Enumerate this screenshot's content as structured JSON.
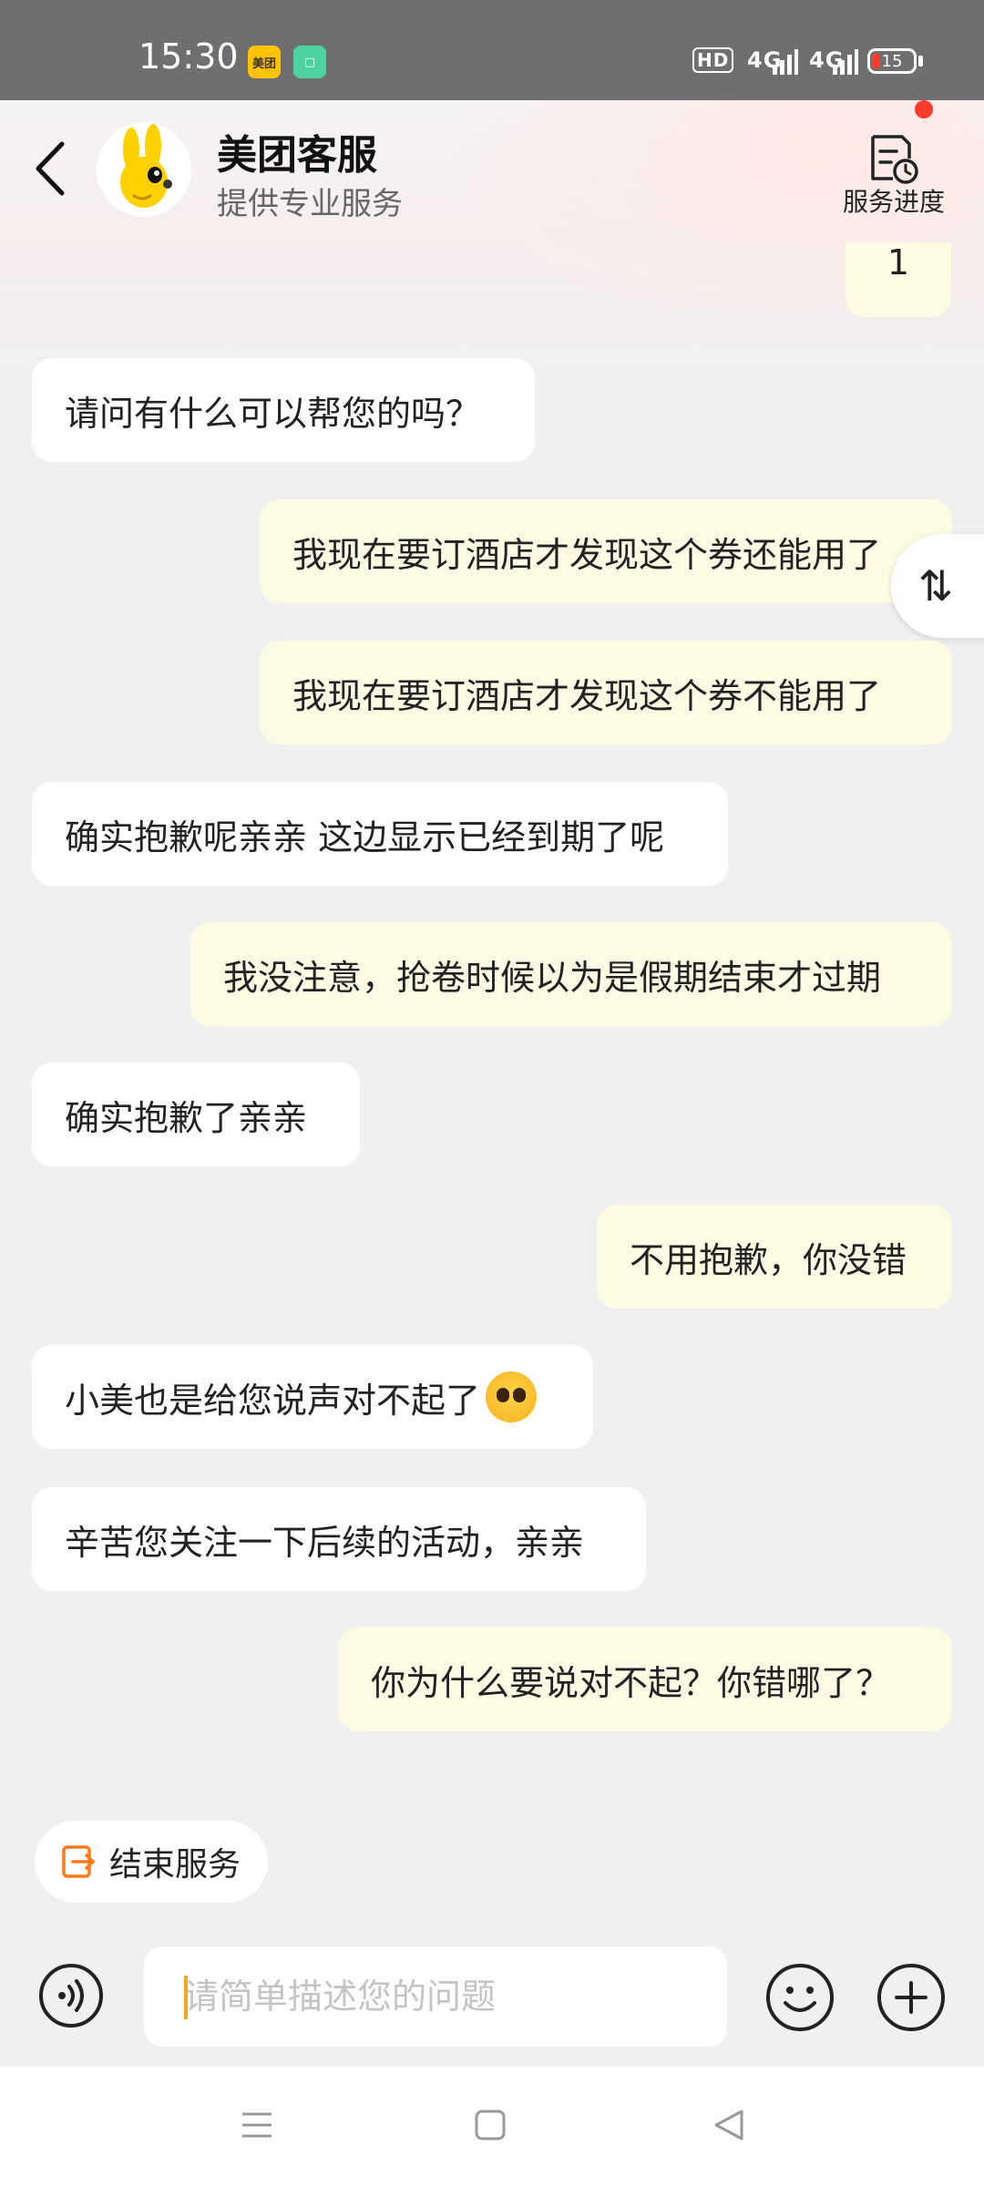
{
  "status_bar": {
    "time": "15:30",
    "app_icon_meituan": "美团",
    "network_hd": "HD",
    "signal_1": "4G",
    "signal_2": "4G",
    "battery": "15"
  },
  "header": {
    "title": "美团客服",
    "subtitle": "提供专业服务",
    "progress_label": "服务进度"
  },
  "partial_message": "1",
  "messages": [
    {
      "side": "left",
      "text": "请问有什么可以帮您的吗？"
    },
    {
      "side": "right",
      "text": "我现在要订酒店才发现这个券还能用了"
    },
    {
      "side": "right",
      "text": "我现在要订酒店才发现这个券不能用了"
    },
    {
      "side": "left",
      "text": "确实抱歉呢亲亲 这边显示已经到期了呢"
    },
    {
      "side": "right",
      "text": "我没注意，抢卷时候以为是假期结束才过期"
    },
    {
      "side": "left",
      "text": "确实抱歉了亲亲"
    },
    {
      "side": "right",
      "text": "不用抱歉，你没错"
    },
    {
      "side": "left",
      "text": "小美也是给您说声对不起了"
    },
    {
      "side": "left",
      "text": "辛苦您关注一下后续的活动，亲亲"
    },
    {
      "side": "right",
      "text": "你为什么要说对不起？你错哪了？"
    }
  ],
  "swap_button": "⇅",
  "end_service": {
    "label": "结束服务"
  },
  "input": {
    "placeholder": "请简单描述您的问题",
    "value": ""
  },
  "colors": {
    "accent": "#f5a623",
    "user_bubble": "#fdfbe4",
    "agent_bubble": "#ffffff",
    "notification": "#ff3b30"
  }
}
